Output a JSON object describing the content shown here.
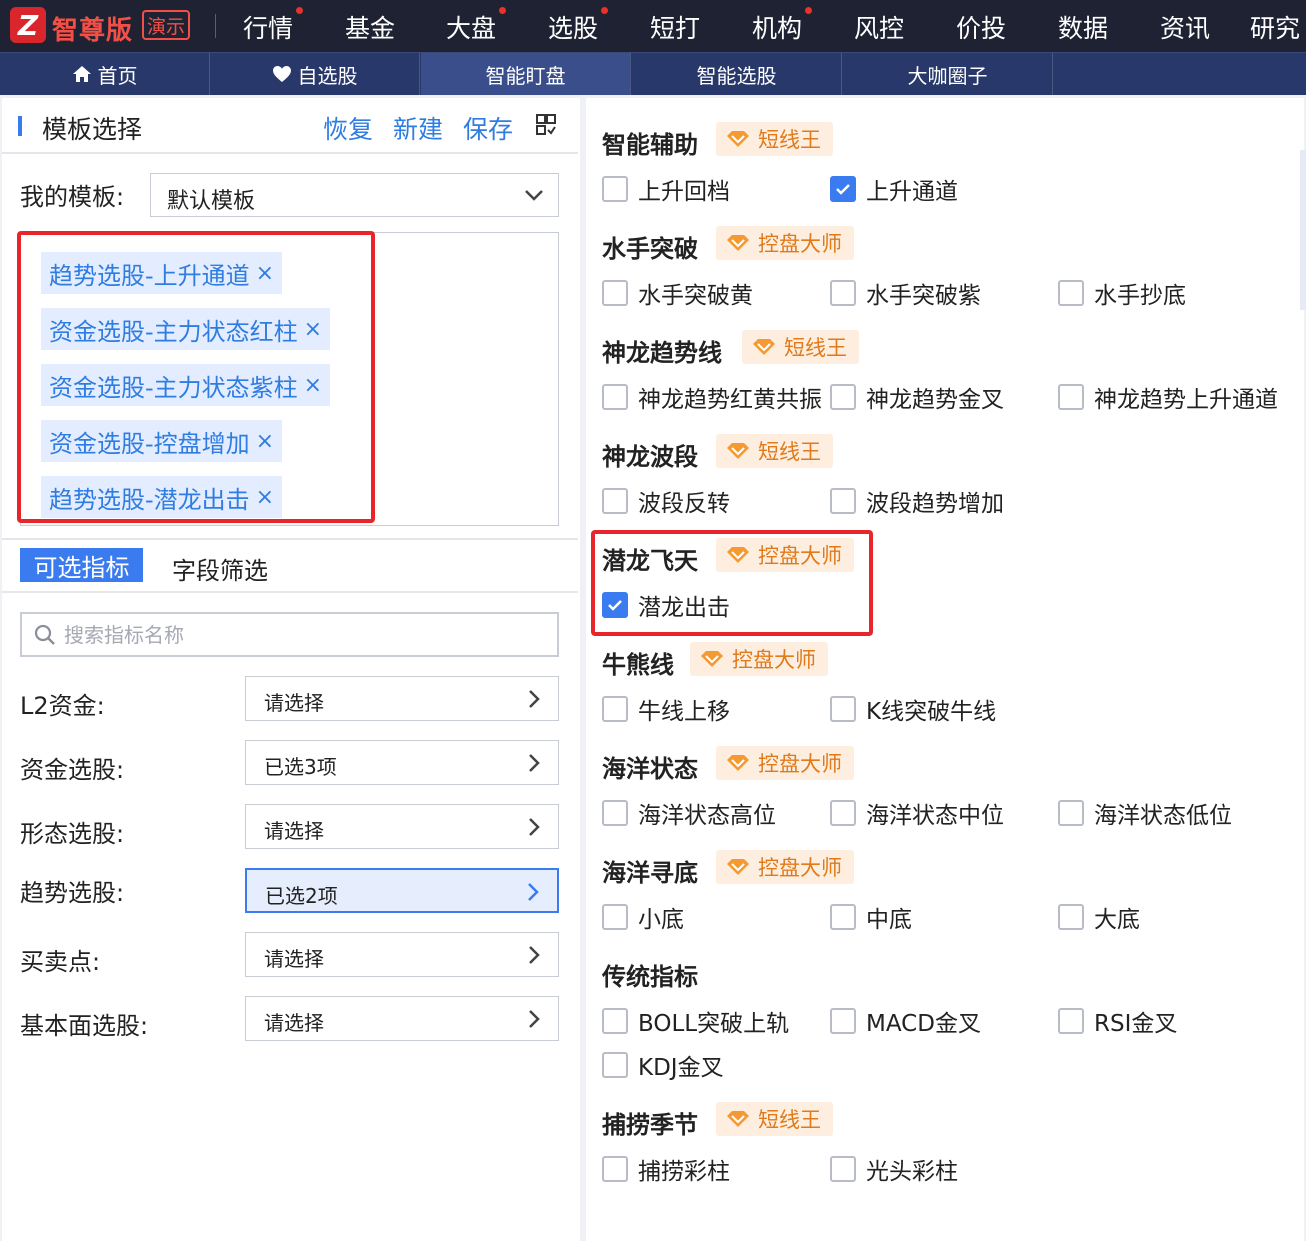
{
  "top_nav": {
    "brand": "智尊版",
    "demo_badge": "演示",
    "items": [
      {
        "label": "行情",
        "dot": true
      },
      {
        "label": "基金",
        "dot": false
      },
      {
        "label": "大盘",
        "dot": true
      },
      {
        "label": "选股",
        "dot": true
      },
      {
        "label": "短打",
        "dot": false
      },
      {
        "label": "机构",
        "dot": true
      },
      {
        "label": "风控",
        "dot": false
      },
      {
        "label": "价投",
        "dot": false
      },
      {
        "label": "数据",
        "dot": false
      },
      {
        "label": "资讯",
        "dot": false
      },
      {
        "label": "研究",
        "dot": false
      }
    ]
  },
  "sub_nav": {
    "items": [
      {
        "label": "首页",
        "icon": "home-icon",
        "active": false
      },
      {
        "label": "自选股",
        "icon": "heart-icon",
        "active": false
      },
      {
        "label": "智能盯盘",
        "icon": "",
        "active": true
      },
      {
        "label": "智能选股",
        "icon": "",
        "active": false
      },
      {
        "label": "大咖圈子",
        "icon": "",
        "active": false
      }
    ]
  },
  "template_panel": {
    "title": "模板选择",
    "actions": {
      "restore": "恢复",
      "new": "新建",
      "save": "保存"
    },
    "my_template_label": "我的模板:",
    "my_template_value": "默认模板",
    "selected_tags": [
      "趋势选股-上升通道",
      "资金选股-主力状态红柱",
      "资金选股-主力状态紫柱",
      "资金选股-控盘增加",
      "趋势选股-潜龙出击"
    ],
    "tab_indicators": "可选指标",
    "tab_fields": "字段筛选",
    "search_placeholder": "搜索指标名称",
    "filters": [
      {
        "label": "L2资金:",
        "value": "请选择",
        "active": false
      },
      {
        "label": "资金选股:",
        "value": "已选3项",
        "active": false
      },
      {
        "label": "形态选股:",
        "value": "请选择",
        "active": false
      },
      {
        "label": "趋势选股:",
        "value": "已选2项",
        "active": true
      },
      {
        "label": "买卖点:",
        "value": "请选择",
        "active": false
      },
      {
        "label": "基本面选股:",
        "value": "请选择",
        "active": false
      }
    ]
  },
  "indicator_panel": {
    "groups": [
      {
        "title": "智能辅助",
        "badge": "短线王",
        "items": [
          {
            "label": "上升回档",
            "checked": false
          },
          {
            "label": "上升通道",
            "checked": true
          }
        ]
      },
      {
        "title": "水手突破",
        "badge": "控盘大师",
        "items": [
          {
            "label": "水手突破黄",
            "checked": false
          },
          {
            "label": "水手突破紫",
            "checked": false
          },
          {
            "label": "水手抄底",
            "checked": false
          }
        ]
      },
      {
        "title": "神龙趋势线",
        "badge": "短线王",
        "items": [
          {
            "label": "神龙趋势红黄共振",
            "checked": false
          },
          {
            "label": "神龙趋势金叉",
            "checked": false
          },
          {
            "label": "神龙趋势上升通道",
            "checked": false
          }
        ]
      },
      {
        "title": "神龙波段",
        "badge": "短线王",
        "items": [
          {
            "label": "波段反转",
            "checked": false
          },
          {
            "label": "波段趋势增加",
            "checked": false
          }
        ]
      },
      {
        "title": "潜龙飞天",
        "badge": "控盘大师",
        "items": [
          {
            "label": "潜龙出击",
            "checked": true
          }
        ]
      },
      {
        "title": "牛熊线",
        "badge": "控盘大师",
        "items": [
          {
            "label": "牛线上移",
            "checked": false
          },
          {
            "label": "K线突破牛线",
            "checked": false
          }
        ]
      },
      {
        "title": "海洋状态",
        "badge": "控盘大师",
        "items": [
          {
            "label": "海洋状态高位",
            "checked": false
          },
          {
            "label": "海洋状态中位",
            "checked": false
          },
          {
            "label": "海洋状态低位",
            "checked": false
          }
        ]
      },
      {
        "title": "海洋寻底",
        "badge": "控盘大师",
        "items": [
          {
            "label": "小底",
            "checked": false
          },
          {
            "label": "中底",
            "checked": false
          },
          {
            "label": "大底",
            "checked": false
          }
        ]
      },
      {
        "title": "传统指标",
        "badge": "",
        "items": [
          {
            "label": "BOLL突破上轨",
            "checked": false
          },
          {
            "label": "MACD金叉",
            "checked": false
          },
          {
            "label": "RSI金叉",
            "checked": false
          },
          {
            "label": "KDJ金叉",
            "checked": false
          }
        ]
      },
      {
        "title": "捕捞季节",
        "badge": "短线王",
        "items": [
          {
            "label": "捕捞彩柱",
            "checked": false
          },
          {
            "label": "光头彩柱",
            "checked": false
          }
        ]
      }
    ]
  },
  "colors": {
    "accent": "#3a7bf0",
    "highlight_border": "#e8252a",
    "badge_text": "#e07a1a",
    "top_nav_bg": "#1e2232",
    "sub_nav_bg": "#29386a"
  }
}
